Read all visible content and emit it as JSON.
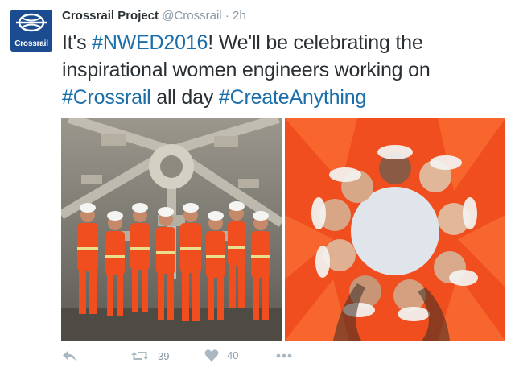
{
  "account": {
    "logo_text": "Crossrail",
    "name": "Crossrail Project",
    "handle": "@Crossrail",
    "separator": "·",
    "time": "2h"
  },
  "tweet": {
    "t1": "It's ",
    "tag1": "#NWED2016",
    "t2": "! We'll be celebrating the inspirational women engineers working on ",
    "tag2": "#Crossrail",
    "t3": " all day ",
    "tag3": "#CreateAnything"
  },
  "colors": {
    "brand": "#1b4c8f",
    "hashtag": "#1b6ea8",
    "hi_vis_orange": "#f04e1e",
    "action_gray": "#aab8c2"
  },
  "actions": {
    "reply_icon": "reply-icon",
    "retweet_icon": "retweet-icon",
    "retweet_count": "39",
    "like_icon": "heart-icon",
    "like_count": "40",
    "more_icon": "more-icon"
  }
}
